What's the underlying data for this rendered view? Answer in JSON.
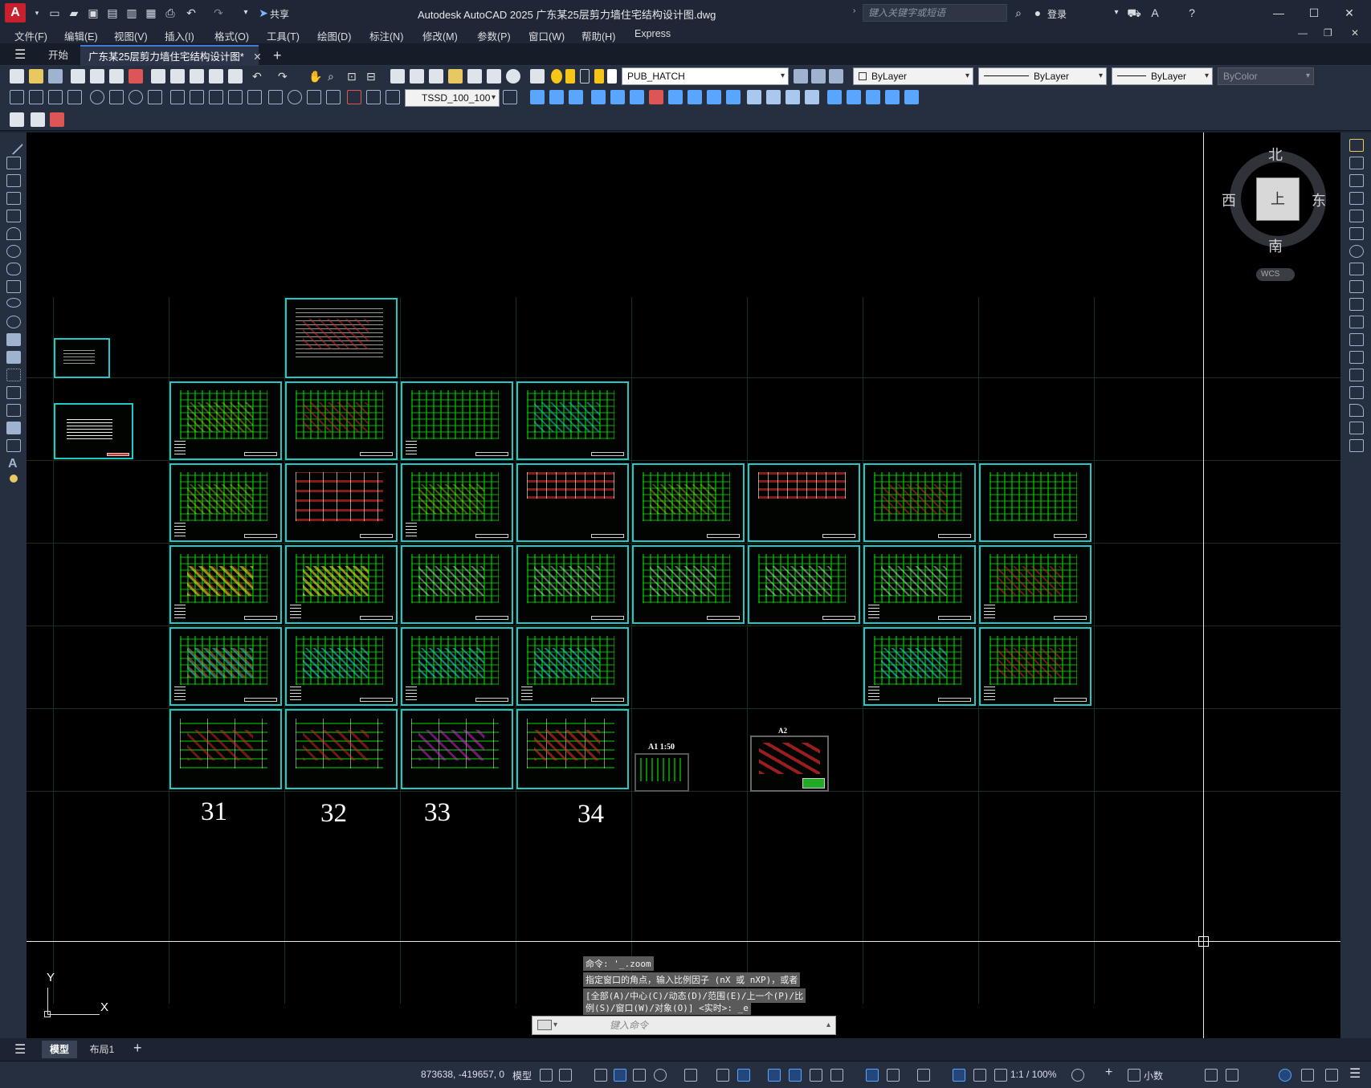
{
  "app": {
    "title": "Autodesk AutoCAD 2025    广东某25层剪力墙住宅结构设计图.dwg",
    "logo": "A",
    "share": "共享",
    "search_placeholder": "键入关键字或短语",
    "login": "登录"
  },
  "menu": [
    "文件(F)",
    "编辑(E)",
    "视图(V)",
    "插入(I)",
    "格式(O)",
    "工具(T)",
    "绘图(D)",
    "标注(N)",
    "修改(M)",
    "参数(P)",
    "窗口(W)",
    "帮助(H)",
    "Express"
  ],
  "tabs": {
    "start": "开始",
    "doc": "广东某25层剪力墙住宅结构设计图*",
    "add": "+"
  },
  "toolbar": {
    "layer": "PUB_HATCH",
    "color": "ByLayer",
    "linetype": "ByLayer",
    "lineweight": "ByLayer",
    "plotstyle": "ByColor",
    "dimstyle": "TSSD_100_100"
  },
  "viewcube": {
    "north": "北",
    "south": "南",
    "east": "东",
    "west": "西",
    "top": "上",
    "wcs": "WCS"
  },
  "drawing": {
    "n31": "31",
    "n32": "32",
    "n33": "33",
    "n34": "34",
    "label_a1": "A1 1:50",
    "label_a2": "A2"
  },
  "ucs": {
    "y": "Y",
    "x": "X"
  },
  "command": {
    "line1": "命令: '_.zoom",
    "line2": "指定窗口的角点，输入比例因子 (nX 或 nXP)，或者",
    "line3": "[全部(A)/中心(C)/动态(D)/范围(E)/上一个(P)/比",
    "line4": "例(S)/窗口(W)/对象(O)] <实时>: _e",
    "placeholder": "键入命令"
  },
  "layout_tabs": {
    "model": "模型",
    "layout1": "布局1"
  },
  "status": {
    "coords": "873638, -419657, 0",
    "model": "模型",
    "scale": "1:1 / 100%",
    "units": "小数"
  }
}
